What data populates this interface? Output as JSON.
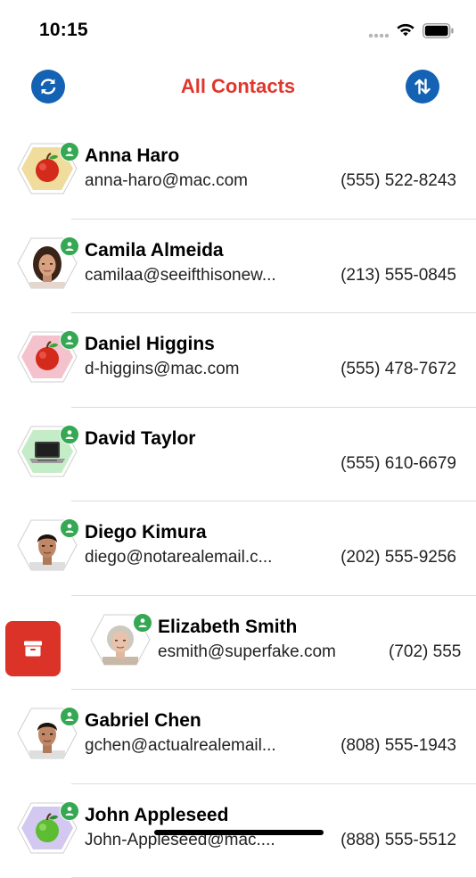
{
  "status_bar": {
    "time": "10:15"
  },
  "nav": {
    "title": "All Contacts",
    "left_icon": "refresh-icon",
    "right_icon": "sort-arrows-icon"
  },
  "colors": {
    "accent_red": "#e0362c",
    "nav_button_blue": "#1462b3",
    "badge_green": "#34a853",
    "archive_red": "#dc3328"
  },
  "contacts": [
    {
      "name": "Anna Haro",
      "email": "anna-haro@mac.com",
      "phone": "(555) 522-8243",
      "avatar": "apple",
      "hex_color": "#f0dc9c"
    },
    {
      "name": "Camila Almeida",
      "email": "camilaa@seeifthisonew...",
      "phone": "(213) 555-0845",
      "avatar": "photo-woman",
      "hex_color": "#ffffff"
    },
    {
      "name": "Daniel Higgins",
      "email": "d-higgins@mac.com",
      "phone": "(555) 478-7672",
      "avatar": "apple",
      "hex_color": "#f4c2cc"
    },
    {
      "name": "David Taylor",
      "email": "",
      "phone": "(555) 610-6679",
      "avatar": "laptop",
      "hex_color": "#c4ecc6"
    },
    {
      "name": "Diego Kimura",
      "email": "diego@notarealemail.c...",
      "phone": "(202) 555-9256",
      "avatar": "photo-man",
      "hex_color": "#ffffff"
    },
    {
      "name": "Elizabeth Smith",
      "email": "esmith@superfake.com",
      "phone": "(702) 555",
      "avatar": "photo-elder",
      "hex_color": "#ffffff",
      "swiped": true
    },
    {
      "name": "Gabriel Chen",
      "email": "gchen@actualrealemail...",
      "phone": "(808) 555-1943",
      "avatar": "photo-man",
      "hex_color": "#ffffff"
    },
    {
      "name": "John Appleseed",
      "email": "John-Appleseed@mac....",
      "phone": "(888) 555-5512",
      "avatar": "green-apple",
      "hex_color": "#d2c8f0"
    }
  ],
  "swipe_action": {
    "icon": "archive-icon"
  }
}
